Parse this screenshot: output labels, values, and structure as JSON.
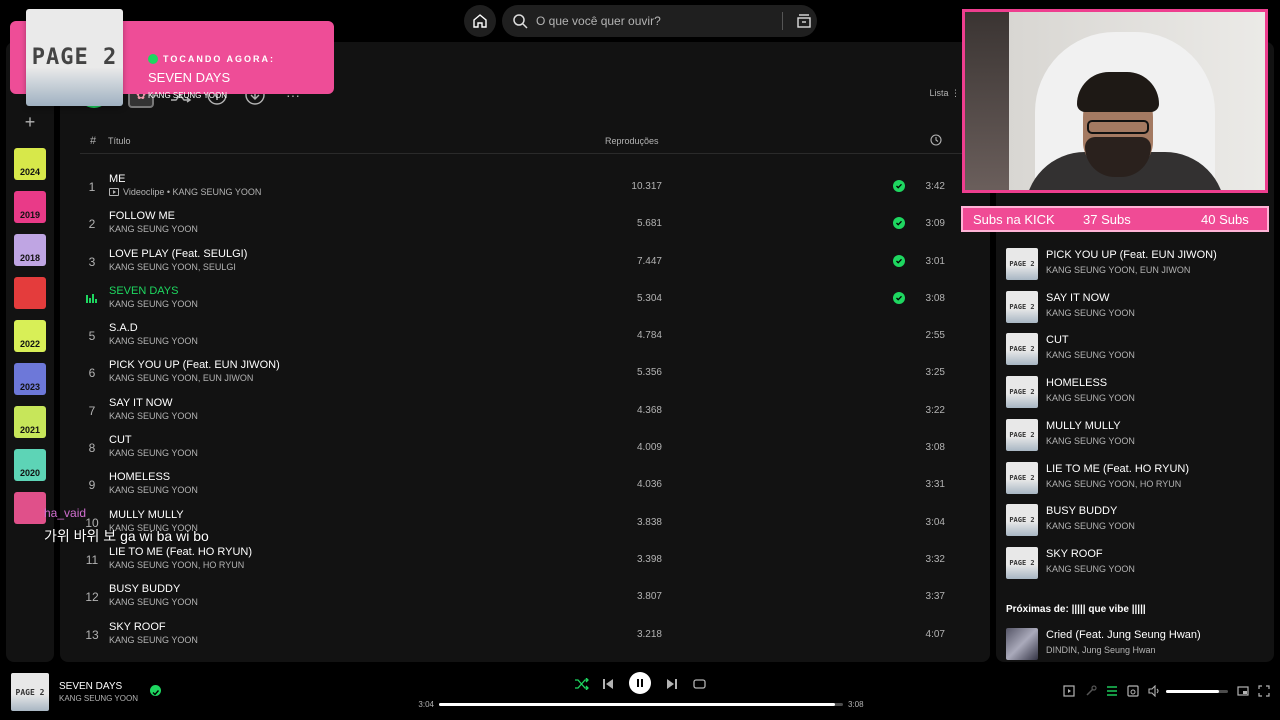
{
  "search": {
    "placeholder": "O que você quer ouvir?"
  },
  "now_playing_popup": {
    "tag": "TOCANDO AGORA:",
    "title": "SEVEN DAYS",
    "artist": "KANG SEUNG YOON",
    "cover_text": "PAGE 2"
  },
  "sidebar": {
    "plus": "+",
    "covers": [
      {
        "label": "2024",
        "color": "#d7e84a"
      },
      {
        "label": "2019",
        "color": "#e93a88"
      },
      {
        "label": "2018",
        "color": "#bfa5e3"
      },
      {
        "label": "",
        "color": "#e43c3c"
      },
      {
        "label": "2022",
        "color": "#d8ef57"
      },
      {
        "label": "2023",
        "color": "#6d78d9"
      },
      {
        "label": "2021",
        "color": "#c7e65a"
      },
      {
        "label": "2020",
        "color": "#5dd4b6"
      },
      {
        "label": "",
        "color": "#e0508a"
      }
    ]
  },
  "main": {
    "view_label": "Lista",
    "headers": {
      "hash": "#",
      "title": "Título",
      "plays": "Reproduções"
    },
    "tracks": [
      {
        "num": "1",
        "title": "ME",
        "artist": "Videoclipe • KANG SEUNG YOON",
        "video": true,
        "plays": "10.317",
        "saved": true,
        "duration": "3:42"
      },
      {
        "num": "2",
        "title": "FOLLOW ME",
        "artist": "KANG SEUNG YOON",
        "plays": "5.681",
        "saved": true,
        "duration": "3:09"
      },
      {
        "num": "3",
        "title": "LOVE PLAY (Feat. SEULGI)",
        "artist": "KANG SEUNG YOON, SEULGI",
        "plays": "7.447",
        "saved": true,
        "duration": "3:01"
      },
      {
        "num": "",
        "title": "SEVEN DAYS",
        "artist": "KANG SEUNG YOON",
        "plays": "5.304",
        "saved": true,
        "duration": "3:08",
        "playing": true
      },
      {
        "num": "5",
        "title": "S.A.D",
        "artist": "KANG SEUNG YOON",
        "plays": "4.784",
        "saved": false,
        "duration": "2:55"
      },
      {
        "num": "6",
        "title": "PICK YOU UP (Feat. EUN JIWON)",
        "artist": "KANG SEUNG YOON, EUN JIWON",
        "plays": "5.356",
        "saved": false,
        "duration": "3:25"
      },
      {
        "num": "7",
        "title": "SAY IT NOW",
        "artist": "KANG SEUNG YOON",
        "plays": "4.368",
        "saved": false,
        "duration": "3:22"
      },
      {
        "num": "8",
        "title": "CUT",
        "artist": "KANG SEUNG YOON",
        "plays": "4.009",
        "saved": false,
        "duration": "3:08"
      },
      {
        "num": "9",
        "title": "HOMELESS",
        "artist": "KANG SEUNG YOON",
        "plays": "4.036",
        "saved": false,
        "duration": "3:31"
      },
      {
        "num": "10",
        "title": "MULLY MULLY",
        "artist": "KANG SEUNG YOON",
        "plays": "3.838",
        "saved": false,
        "duration": "3:04"
      },
      {
        "num": "11",
        "title": "LIE TO ME (Feat. HO RYUN)",
        "artist": "KANG SEUNG YOON, HO RYUN",
        "plays": "3.398",
        "saved": false,
        "duration": "3:32"
      },
      {
        "num": "12",
        "title": "BUSY BUDDY",
        "artist": "KANG SEUNG YOON",
        "plays": "3.807",
        "saved": false,
        "duration": "3:37"
      },
      {
        "num": "13",
        "title": "SKY ROOF",
        "artist": "KANG SEUNG YOON",
        "plays": "3.218",
        "saved": false,
        "duration": "4:07"
      }
    ]
  },
  "queue": {
    "items": [
      {
        "title": "PICK YOU UP (Feat. EUN JIWON)",
        "artist": "KANG SEUNG YOON, EUN JIWON",
        "thumb": "PAGE 2"
      },
      {
        "title": "SAY IT NOW",
        "artist": "KANG SEUNG YOON",
        "thumb": "PAGE 2"
      },
      {
        "title": "CUT",
        "artist": "KANG SEUNG YOON",
        "thumb": "PAGE 2"
      },
      {
        "title": "HOMELESS",
        "artist": "KANG SEUNG YOON",
        "thumb": "PAGE 2"
      },
      {
        "title": "MULLY MULLY",
        "artist": "KANG SEUNG YOON",
        "thumb": "PAGE 2"
      },
      {
        "title": "LIE TO ME (Feat. HO RYUN)",
        "artist": "KANG SEUNG YOON, HO RYUN",
        "thumb": "PAGE 2"
      },
      {
        "title": "BUSY BUDDY",
        "artist": "KANG SEUNG YOON",
        "thumb": "PAGE 2"
      },
      {
        "title": "SKY ROOF",
        "artist": "KANG SEUNG YOON",
        "thumb": "PAGE 2"
      }
    ],
    "next_from_label": "Próximas de: ||||| que vibe |||||",
    "next_item": {
      "title": "Cried (Feat. Jung Seung Hwan)",
      "artist": "DINDIN, Jung Seung Hwan"
    }
  },
  "subs_bar": {
    "label": "Subs na KICK",
    "current": "37 Subs",
    "goal": "40 Subs"
  },
  "chat": {
    "user": "ha_vaid",
    "message": "가위 바위 보 ga wi ba wi bo"
  },
  "player": {
    "title": "SEVEN DAYS",
    "artist": "KANG SEUNG YOON",
    "cover_text": "PAGE 2",
    "elapsed": "3:04",
    "total": "3:08",
    "progress": 0.98,
    "volume": 0.85
  },
  "colors": {
    "accent": "#1ed760",
    "overlay_pink": "#ee4d97"
  }
}
